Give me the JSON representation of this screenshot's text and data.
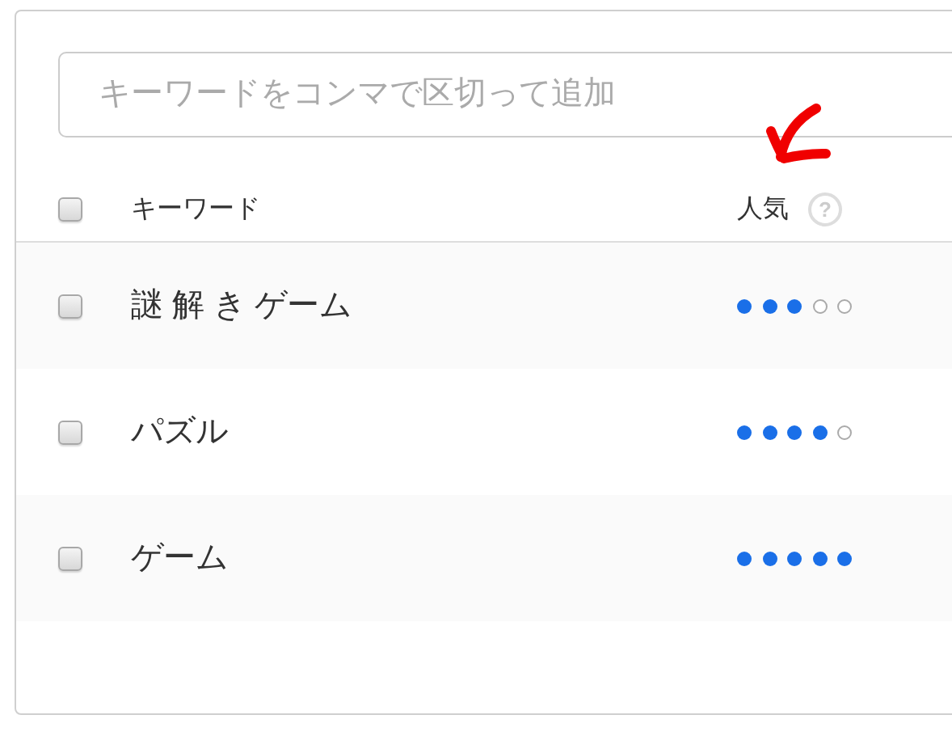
{
  "search": {
    "placeholder": "キーワードをコンマで区切って追加"
  },
  "table": {
    "select_all": {
      "checked": false
    },
    "columns": [
      "キーワード",
      "人気"
    ],
    "help": "?",
    "rows": [
      {
        "keyword": "謎 解 き ゲーム",
        "checked": false,
        "stars": 3
      },
      {
        "keyword": "パズル",
        "checked": false,
        "stars": 4
      },
      {
        "keyword": "ゲーム",
        "checked": false,
        "stars": 5
      }
    ]
  }
}
